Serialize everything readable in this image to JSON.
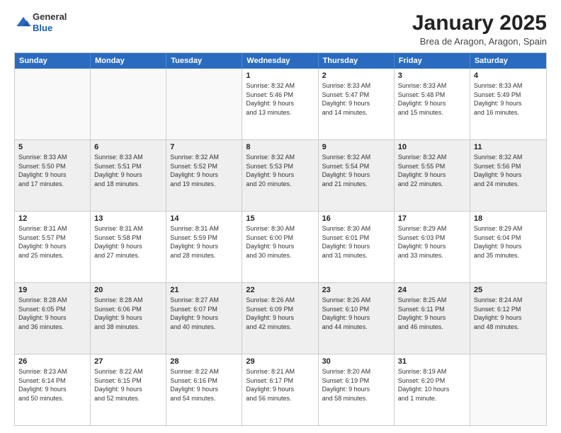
{
  "header": {
    "logo": {
      "line1": "General",
      "line2": "Blue"
    },
    "title": "January 2025",
    "location": "Brea de Aragon, Aragon, Spain"
  },
  "weekdays": [
    "Sunday",
    "Monday",
    "Tuesday",
    "Wednesday",
    "Thursday",
    "Friday",
    "Saturday"
  ],
  "weeks": [
    [
      {
        "day": "",
        "info": ""
      },
      {
        "day": "",
        "info": ""
      },
      {
        "day": "",
        "info": ""
      },
      {
        "day": "1",
        "info": "Sunrise: 8:32 AM\nSunset: 5:46 PM\nDaylight: 9 hours\nand 13 minutes."
      },
      {
        "day": "2",
        "info": "Sunrise: 8:33 AM\nSunset: 5:47 PM\nDaylight: 9 hours\nand 14 minutes."
      },
      {
        "day": "3",
        "info": "Sunrise: 8:33 AM\nSunset: 5:48 PM\nDaylight: 9 hours\nand 15 minutes."
      },
      {
        "day": "4",
        "info": "Sunrise: 8:33 AM\nSunset: 5:49 PM\nDaylight: 9 hours\nand 16 minutes."
      }
    ],
    [
      {
        "day": "5",
        "info": "Sunrise: 8:33 AM\nSunset: 5:50 PM\nDaylight: 9 hours\nand 17 minutes."
      },
      {
        "day": "6",
        "info": "Sunrise: 8:33 AM\nSunset: 5:51 PM\nDaylight: 9 hours\nand 18 minutes."
      },
      {
        "day": "7",
        "info": "Sunrise: 8:32 AM\nSunset: 5:52 PM\nDaylight: 9 hours\nand 19 minutes."
      },
      {
        "day": "8",
        "info": "Sunrise: 8:32 AM\nSunset: 5:53 PM\nDaylight: 9 hours\nand 20 minutes."
      },
      {
        "day": "9",
        "info": "Sunrise: 8:32 AM\nSunset: 5:54 PM\nDaylight: 9 hours\nand 21 minutes."
      },
      {
        "day": "10",
        "info": "Sunrise: 8:32 AM\nSunset: 5:55 PM\nDaylight: 9 hours\nand 22 minutes."
      },
      {
        "day": "11",
        "info": "Sunrise: 8:32 AM\nSunset: 5:56 PM\nDaylight: 9 hours\nand 24 minutes."
      }
    ],
    [
      {
        "day": "12",
        "info": "Sunrise: 8:31 AM\nSunset: 5:57 PM\nDaylight: 9 hours\nand 25 minutes."
      },
      {
        "day": "13",
        "info": "Sunrise: 8:31 AM\nSunset: 5:58 PM\nDaylight: 9 hours\nand 27 minutes."
      },
      {
        "day": "14",
        "info": "Sunrise: 8:31 AM\nSunset: 5:59 PM\nDaylight: 9 hours\nand 28 minutes."
      },
      {
        "day": "15",
        "info": "Sunrise: 8:30 AM\nSunset: 6:00 PM\nDaylight: 9 hours\nand 30 minutes."
      },
      {
        "day": "16",
        "info": "Sunrise: 8:30 AM\nSunset: 6:01 PM\nDaylight: 9 hours\nand 31 minutes."
      },
      {
        "day": "17",
        "info": "Sunrise: 8:29 AM\nSunset: 6:03 PM\nDaylight: 9 hours\nand 33 minutes."
      },
      {
        "day": "18",
        "info": "Sunrise: 8:29 AM\nSunset: 6:04 PM\nDaylight: 9 hours\nand 35 minutes."
      }
    ],
    [
      {
        "day": "19",
        "info": "Sunrise: 8:28 AM\nSunset: 6:05 PM\nDaylight: 9 hours\nand 36 minutes."
      },
      {
        "day": "20",
        "info": "Sunrise: 8:28 AM\nSunset: 6:06 PM\nDaylight: 9 hours\nand 38 minutes."
      },
      {
        "day": "21",
        "info": "Sunrise: 8:27 AM\nSunset: 6:07 PM\nDaylight: 9 hours\nand 40 minutes."
      },
      {
        "day": "22",
        "info": "Sunrise: 8:26 AM\nSunset: 6:09 PM\nDaylight: 9 hours\nand 42 minutes."
      },
      {
        "day": "23",
        "info": "Sunrise: 8:26 AM\nSunset: 6:10 PM\nDaylight: 9 hours\nand 44 minutes."
      },
      {
        "day": "24",
        "info": "Sunrise: 8:25 AM\nSunset: 6:11 PM\nDaylight: 9 hours\nand 46 minutes."
      },
      {
        "day": "25",
        "info": "Sunrise: 8:24 AM\nSunset: 6:12 PM\nDaylight: 9 hours\nand 48 minutes."
      }
    ],
    [
      {
        "day": "26",
        "info": "Sunrise: 8:23 AM\nSunset: 6:14 PM\nDaylight: 9 hours\nand 50 minutes."
      },
      {
        "day": "27",
        "info": "Sunrise: 8:22 AM\nSunset: 6:15 PM\nDaylight: 9 hours\nand 52 minutes."
      },
      {
        "day": "28",
        "info": "Sunrise: 8:22 AM\nSunset: 6:16 PM\nDaylight: 9 hours\nand 54 minutes."
      },
      {
        "day": "29",
        "info": "Sunrise: 8:21 AM\nSunset: 6:17 PM\nDaylight: 9 hours\nand 56 minutes."
      },
      {
        "day": "30",
        "info": "Sunrise: 8:20 AM\nSunset: 6:19 PM\nDaylight: 9 hours\nand 58 minutes."
      },
      {
        "day": "31",
        "info": "Sunrise: 8:19 AM\nSunset: 6:20 PM\nDaylight: 10 hours\nand 1 minute."
      },
      {
        "day": "",
        "info": ""
      }
    ]
  ]
}
